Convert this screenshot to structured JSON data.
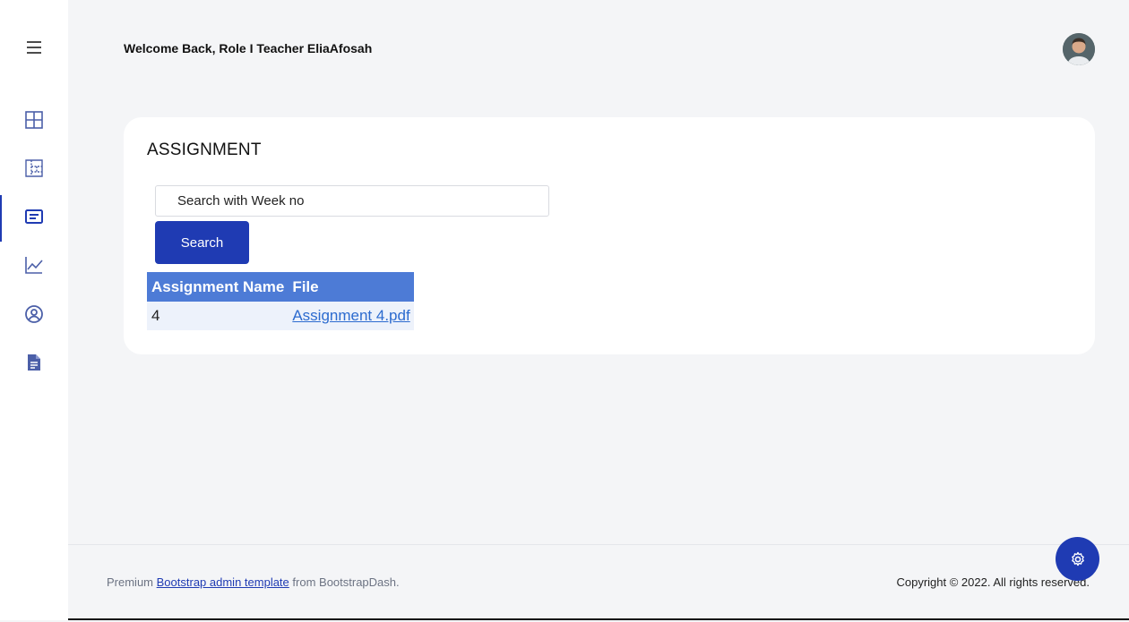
{
  "header": {
    "welcome_text": "Welcome Back, Role I Teacher EliaAfosah"
  },
  "sidebar": {
    "items": [
      {
        "icon": "grid-icon",
        "active": false
      },
      {
        "icon": "layout-icon",
        "active": false
      },
      {
        "icon": "assignment-icon",
        "active": true
      },
      {
        "icon": "chart-line-icon",
        "active": false
      },
      {
        "icon": "user-circle-icon",
        "active": false
      },
      {
        "icon": "document-icon",
        "active": false
      }
    ]
  },
  "card": {
    "title": "ASSIGNMENT",
    "search_placeholder": "Search with Week no",
    "search_button": "Search",
    "table": {
      "headers": [
        "Assignment Name",
        "File"
      ],
      "rows": [
        {
          "name": "4",
          "file": "Assignment 4.pdf"
        }
      ]
    }
  },
  "footer": {
    "prefix": "Premium",
    "link_text": "Bootstrap admin template",
    "suffix": "from BootstrapDash.",
    "copyright": "Copyright © 2022. All rights reserved."
  },
  "colors": {
    "primary": "#1f3bb3",
    "table_header": "#4d7bd6",
    "table_row": "#edf2fb",
    "background": "#f4f5f7"
  }
}
